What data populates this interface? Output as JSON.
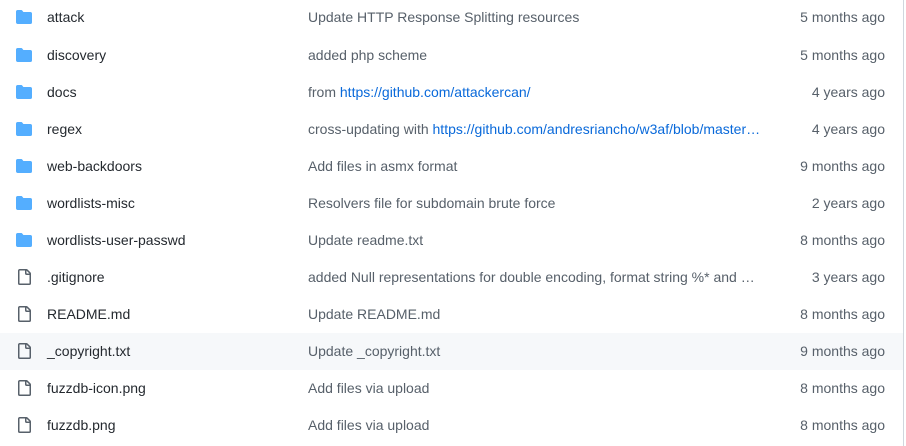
{
  "colors": {
    "folder_icon": "#54aeff",
    "file_icon": "#57606a",
    "link": "#0969da",
    "muted_text": "#57606a",
    "highlight_row": "#f6f8fa"
  },
  "files": [
    {
      "type": "folder",
      "icon": "folder-icon",
      "name": "attack",
      "message": "Update HTTP Response Splitting resources",
      "message_link": "",
      "age": "5 months ago"
    },
    {
      "type": "folder",
      "icon": "folder-icon",
      "name": "discovery",
      "message": "added php scheme",
      "message_link": "",
      "age": "5 months ago"
    },
    {
      "type": "folder",
      "icon": "folder-icon",
      "name": "docs",
      "message": "from ",
      "message_link": "https://github.com/attackercan/",
      "age": "4 years ago"
    },
    {
      "type": "folder",
      "icon": "folder-icon",
      "name": "regex",
      "message": "cross-updating with ",
      "message_link": "https://github.com/andresriancho/w3af/blob/master…",
      "age": "4 years ago"
    },
    {
      "type": "folder",
      "icon": "folder-icon",
      "name": "web-backdoors",
      "message": "Add files in asmx format",
      "message_link": "",
      "age": "9 months ago"
    },
    {
      "type": "folder",
      "icon": "folder-icon",
      "name": "wordlists-misc",
      "message": "Resolvers file for subdomain brute force",
      "message_link": "",
      "age": "2 years ago"
    },
    {
      "type": "folder",
      "icon": "folder-icon",
      "name": "wordlists-user-passwd",
      "message": "Update readme.txt",
      "message_link": "",
      "age": "8 months ago"
    },
    {
      "type": "file",
      "icon": "file-icon",
      "name": ".gitignore",
      "message": "added Null representations for double encoding, format string %* and …",
      "message_link": "",
      "age": "3 years ago"
    },
    {
      "type": "file",
      "icon": "file-icon",
      "name": "README.md",
      "message": "Update README.md",
      "message_link": "",
      "age": "8 months ago"
    },
    {
      "type": "file",
      "icon": "file-icon",
      "name": "_copyright.txt",
      "message": "Update _copyright.txt",
      "message_link": "",
      "age": "9 months ago",
      "highlighted": true
    },
    {
      "type": "file",
      "icon": "file-icon",
      "name": "fuzzdb-icon.png",
      "message": "Add files via upload",
      "message_link": "",
      "age": "8 months ago"
    },
    {
      "type": "file",
      "icon": "file-icon",
      "name": "fuzzdb.png",
      "message": "Add files via upload",
      "message_link": "",
      "age": "8 months ago"
    }
  ]
}
